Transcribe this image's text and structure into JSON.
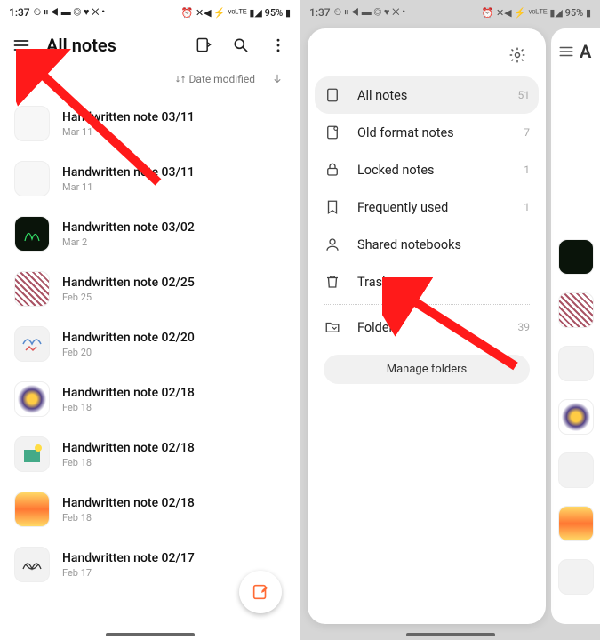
{
  "status": {
    "time": "1:37",
    "left_icons": "⏲ ⏸ ◀ ▬ ◎ ♥ ✕ •",
    "right_icons": "⏰ ✕◀ ⚡ ᵛᵒᴸᵀᴱ ▮◢ 95% ▮"
  },
  "left": {
    "title": "All notes",
    "sort_label": "Date modified",
    "notes": [
      {
        "title": "Handwritten note 03/11",
        "date": "Mar 11",
        "thumb": "blank"
      },
      {
        "title": "Handwritten note 03/11",
        "date": "Mar 11",
        "thumb": "blank"
      },
      {
        "title": "Handwritten note 03/02",
        "date": "Mar 2",
        "thumb": "dark"
      },
      {
        "title": "Handwritten note 02/25",
        "date": "Feb 25",
        "thumb": "pattern1"
      },
      {
        "title": "Handwritten note 02/20",
        "date": "Feb 20",
        "thumb": "pattern2"
      },
      {
        "title": "Handwritten note 02/18",
        "date": "Feb 18",
        "thumb": "pattern3"
      },
      {
        "title": "Handwritten note 02/18",
        "date": "Feb 18",
        "thumb": "pattern4"
      },
      {
        "title": "Handwritten note 02/18",
        "date": "Feb 18",
        "thumb": "gradient"
      },
      {
        "title": "Handwritten note 02/17",
        "date": "Feb 17",
        "thumb": "sketch"
      }
    ]
  },
  "drawer": {
    "items": [
      {
        "label": "All notes",
        "count": "51",
        "icon": "note"
      },
      {
        "label": "Old format notes",
        "count": "7",
        "icon": "old"
      },
      {
        "label": "Locked notes",
        "count": "1",
        "icon": "lock"
      },
      {
        "label": "Frequently used",
        "count": "1",
        "icon": "bookmark"
      },
      {
        "label": "Shared notebooks",
        "count": "",
        "icon": "person"
      },
      {
        "label": "Trash",
        "count": "",
        "icon": "trash"
      }
    ],
    "folders_label": "Folders",
    "folders_count": "39",
    "manage_label": "Manage folders"
  },
  "peek_title": "A"
}
